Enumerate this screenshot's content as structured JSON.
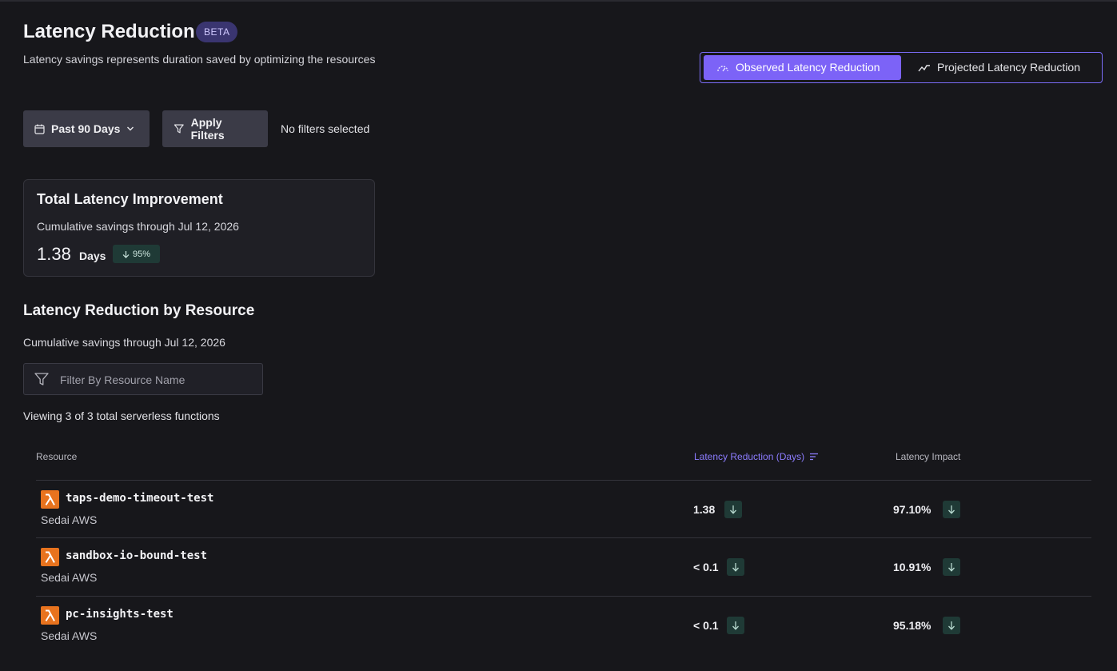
{
  "header": {
    "title": "Latency Reduction",
    "badge": "BETA",
    "subtitle": "Latency savings represents duration saved by optimizing the resources"
  },
  "view_toggle": {
    "options": [
      {
        "label": "Observed Latency Reduction",
        "icon": "gauge-icon",
        "active": true
      },
      {
        "label": "Projected Latency Reduction",
        "icon": "trend-line-icon",
        "active": false
      }
    ]
  },
  "filters": {
    "date_label": "Past 90 Days",
    "apply_label": "Apply Filters",
    "status": "No filters selected"
  },
  "summary_card": {
    "title": "Total Latency Improvement",
    "subtitle": "Cumulative savings through Jul 12, 2026",
    "value": "1.38",
    "unit": "Days",
    "change": "95%"
  },
  "resource_section": {
    "title": "Latency Reduction by Resource",
    "subtitle": "Cumulative savings through Jul 12, 2026",
    "search_placeholder": "Filter By Resource Name",
    "viewing": "Viewing 3 of 3 total serverless functions"
  },
  "table": {
    "columns": [
      "Resource",
      "Latency Reduction (Days)",
      "Latency Impact"
    ],
    "rows": [
      {
        "name": "taps-demo-timeout-test",
        "provider": "Sedai AWS",
        "latency_reduction": "1.38",
        "impact": "97.10%"
      },
      {
        "name": "sandbox-io-bound-test",
        "provider": "Sedai AWS",
        "latency_reduction": "< 0.1",
        "impact": "10.91%"
      },
      {
        "name": "pc-insights-test",
        "provider": "Sedai AWS",
        "latency_reduction": "< 0.1",
        "impact": "95.18%"
      }
    ]
  },
  "colors": {
    "accent": "#7c63f7",
    "positive_chip": "#1f3a36",
    "lambda": "#e8731e"
  }
}
